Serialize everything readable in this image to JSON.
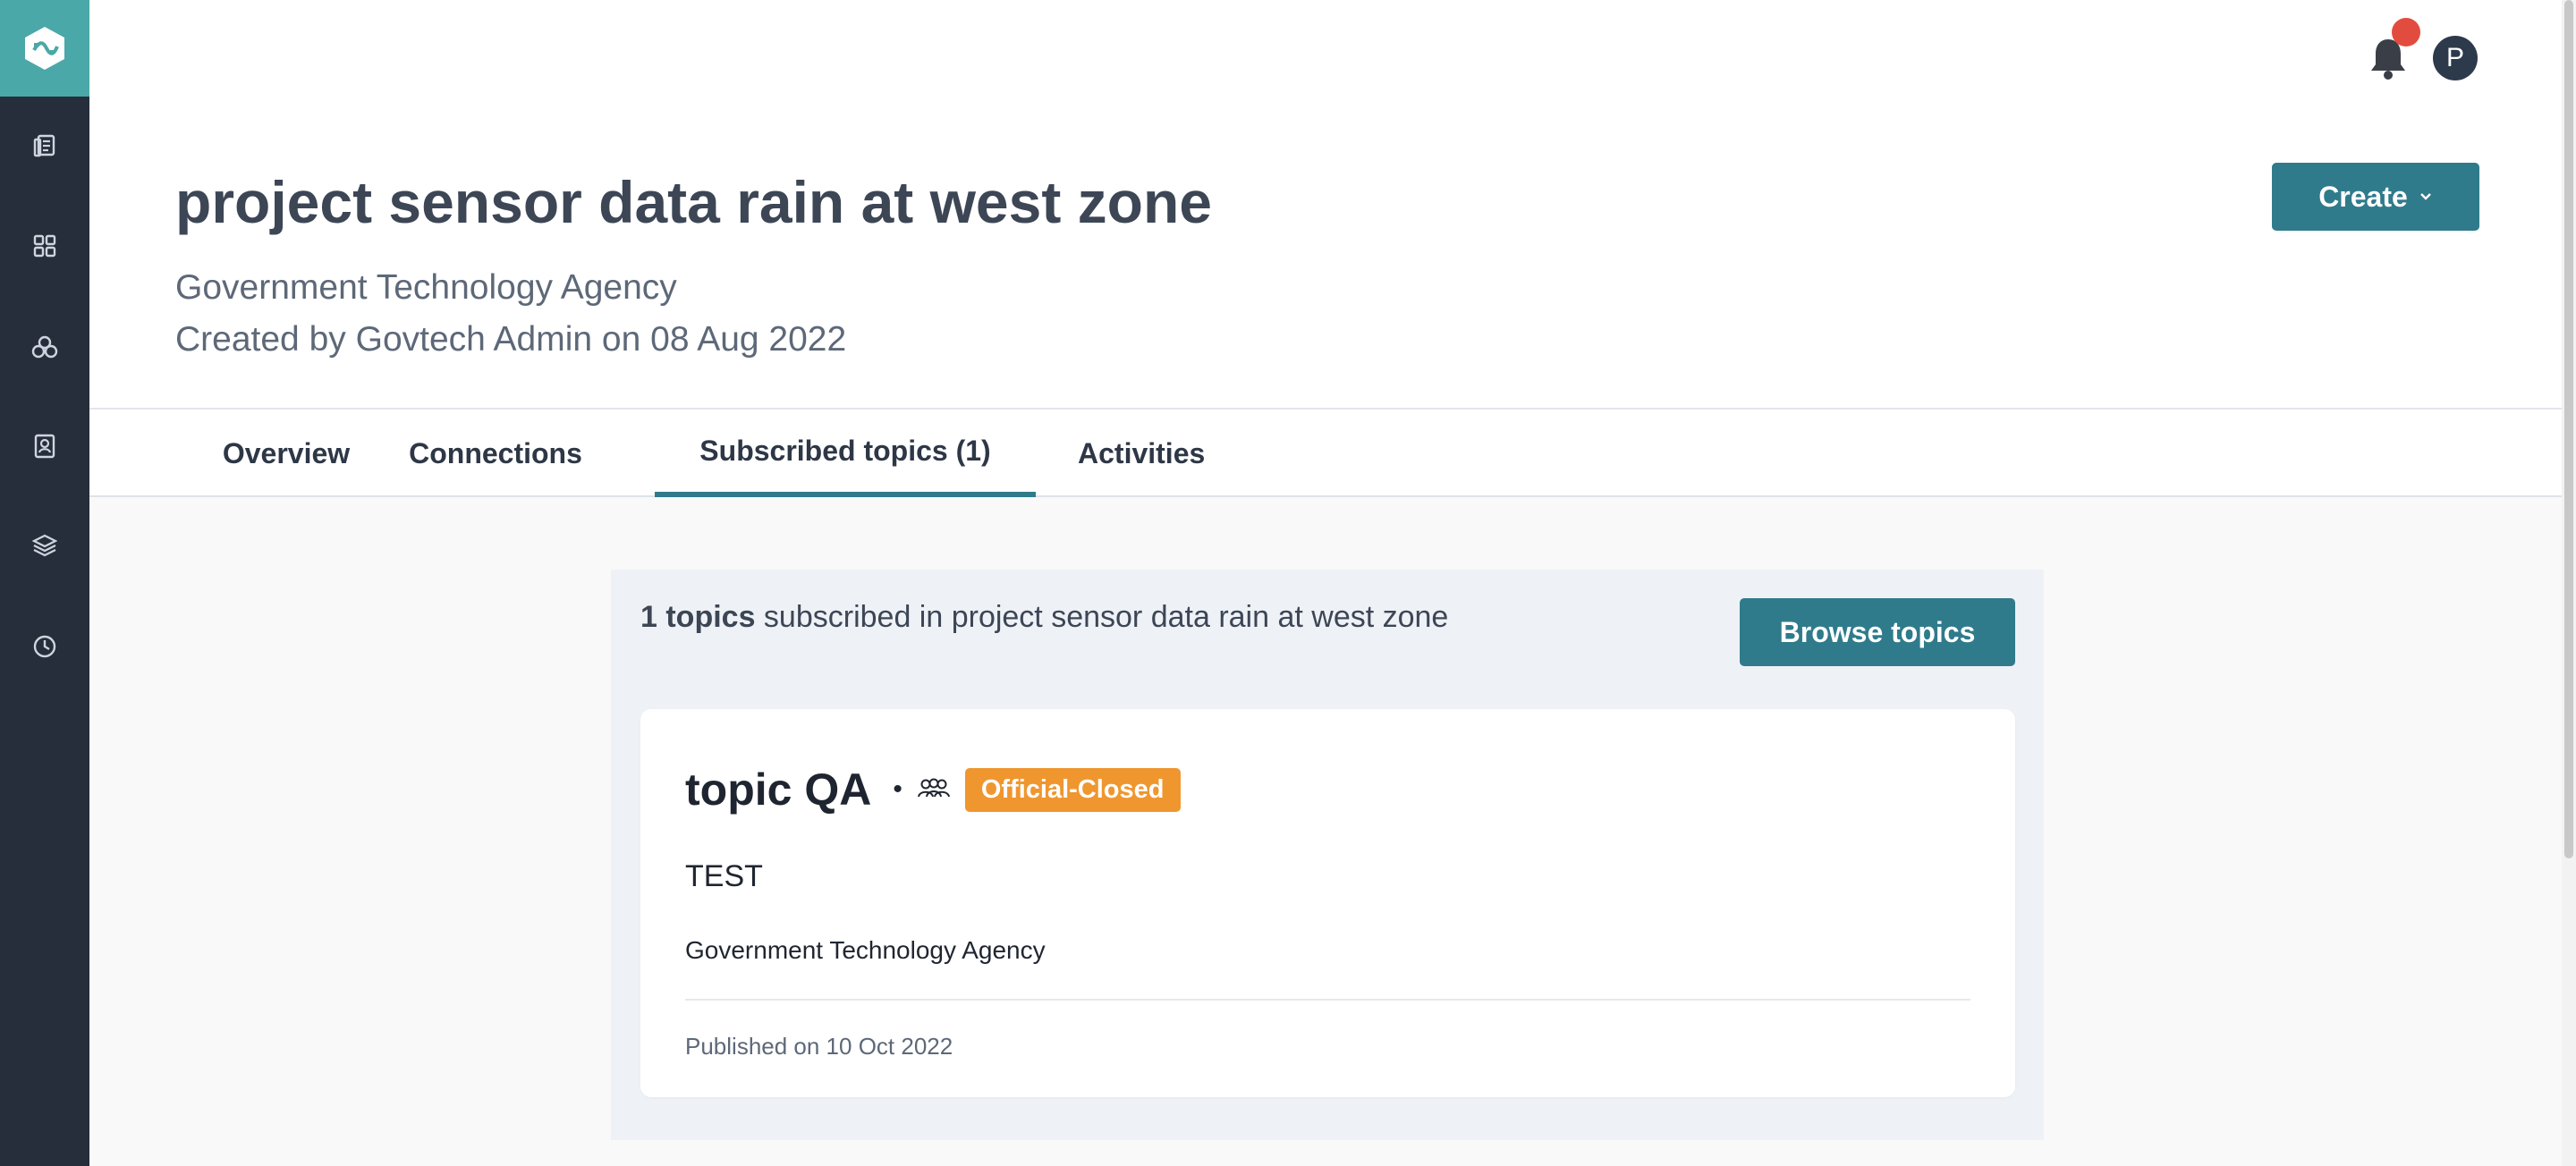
{
  "sidebar": {
    "logo": "app-logo",
    "items": [
      {
        "icon": "documents-icon"
      },
      {
        "icon": "dashboard-icon"
      },
      {
        "icon": "topics-icon"
      },
      {
        "icon": "contacts-icon"
      },
      {
        "icon": "layers-icon"
      },
      {
        "icon": "history-icon"
      }
    ]
  },
  "topbar": {
    "avatar_initial": "P",
    "notification_icon": "bell-icon"
  },
  "project": {
    "title": "project sensor data rain at west zone",
    "agency": "Government Technology Agency",
    "created": "Created by Govtech Admin on 08 Aug 2022"
  },
  "actions": {
    "create_label": "Create"
  },
  "tabs": [
    {
      "label": "Overview"
    },
    {
      "label": "Connections"
    },
    {
      "label": "Subscribed topics (1)",
      "active": true
    },
    {
      "label": "Activities"
    }
  ],
  "summary": {
    "count": "1 topics",
    "rest": " subscribed in project sensor data rain at west zone",
    "browse_label": "Browse topics"
  },
  "topic": {
    "title": "topic QA",
    "dot": "•",
    "badge": "Official-Closed",
    "description": "TEST",
    "agency": "Government Technology Agency",
    "published": "Published on 10 Oct 2022"
  },
  "colors": {
    "accent": "#2f7b8b",
    "logo_bg": "#4aa8a8",
    "sidebar_bg": "#262e3b",
    "badge": "#f0962f",
    "notification": "#e24c3f"
  }
}
